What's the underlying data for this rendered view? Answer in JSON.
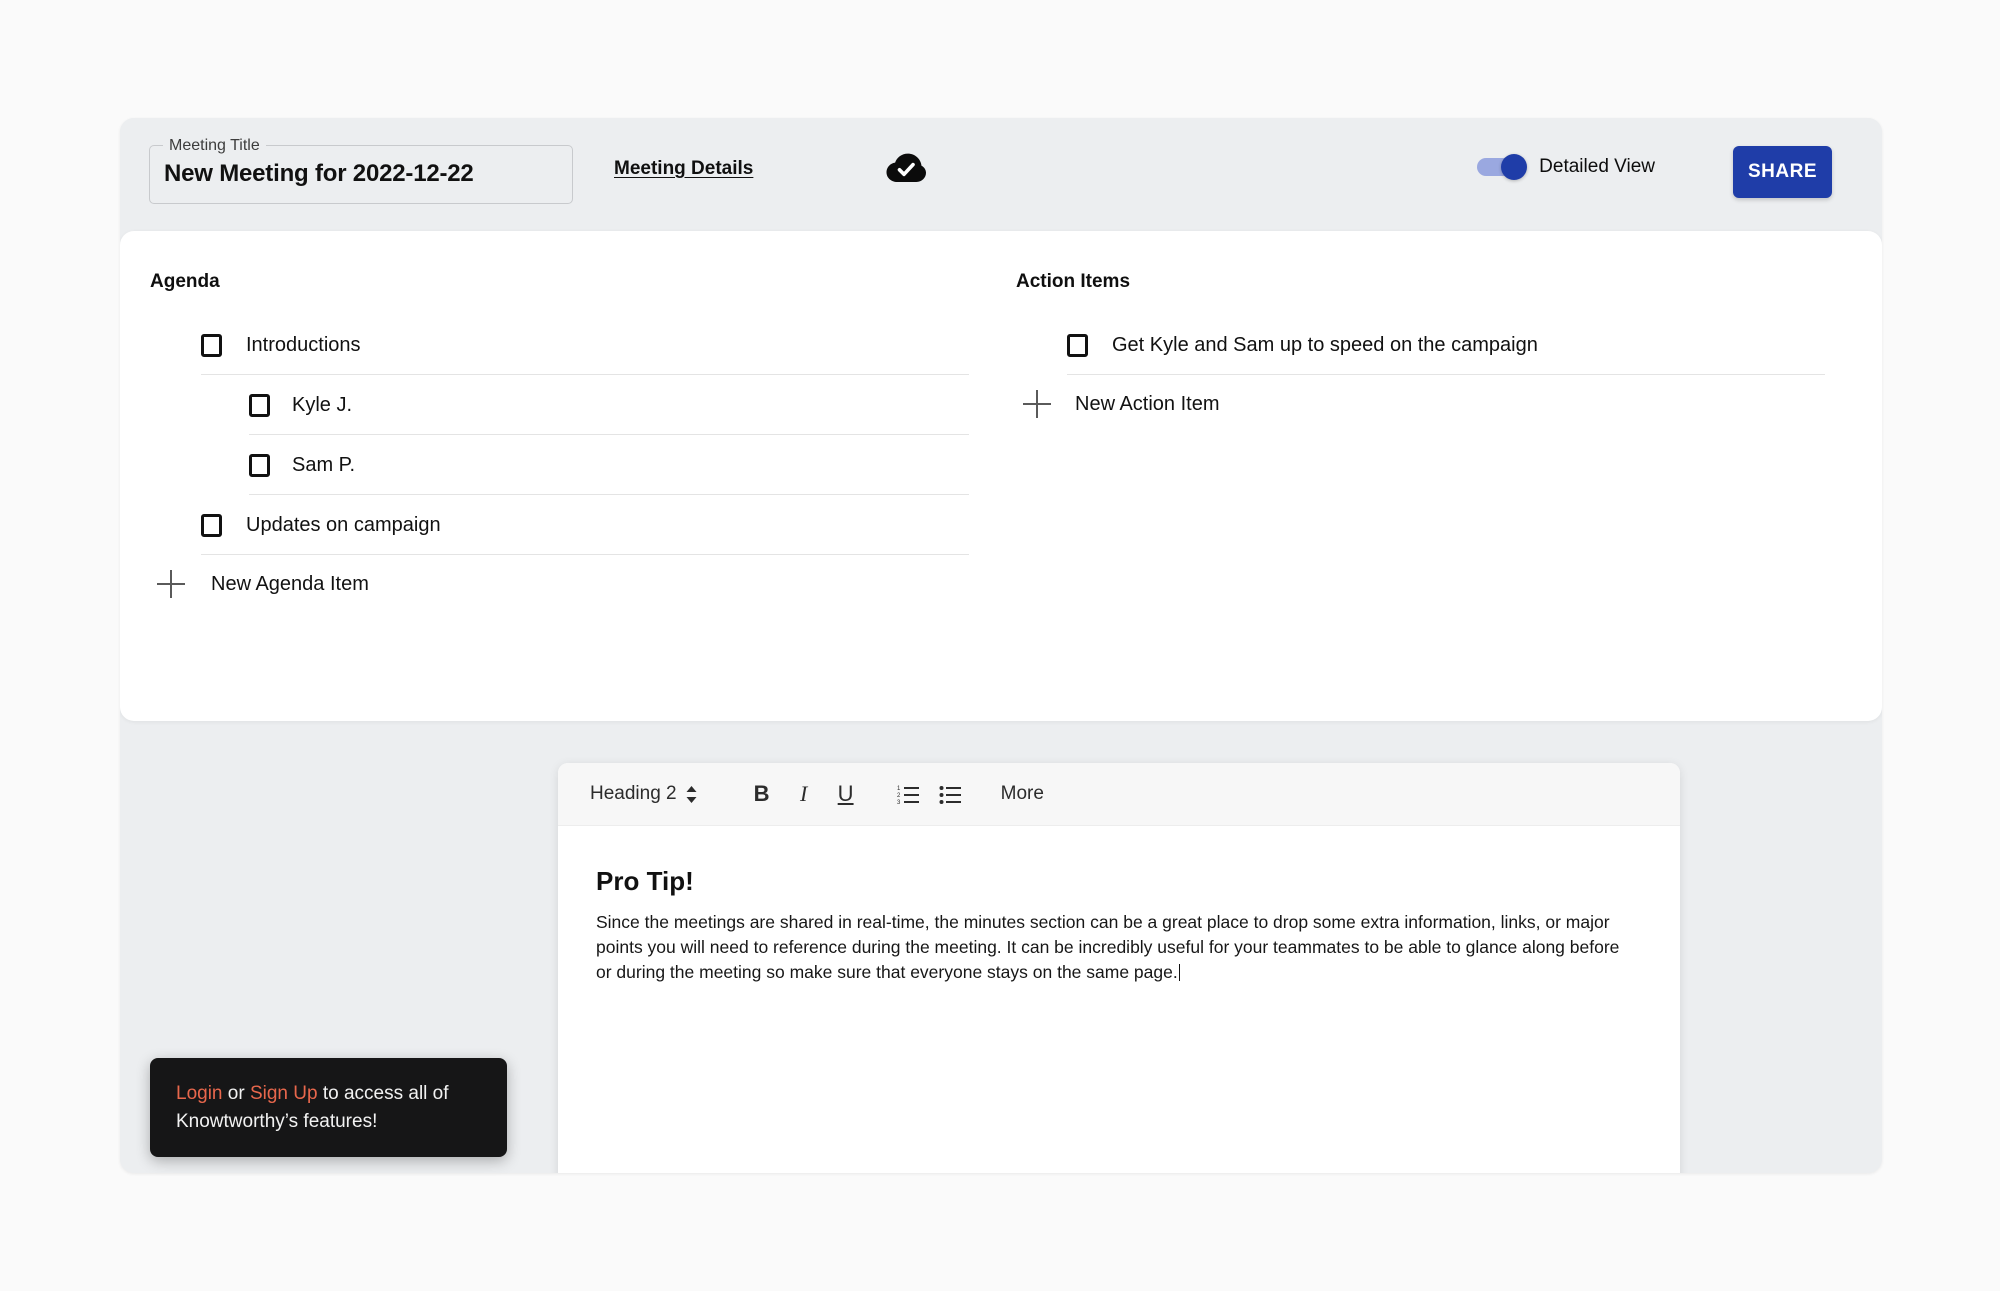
{
  "header": {
    "title_label": "Meeting Title",
    "title_value": "New Meeting for 2022-12-22",
    "meeting_details_link": "Meeting Details",
    "saved_icon": "cloud-check-icon",
    "toggle_label": "Detailed View",
    "toggle_on": true,
    "share_label": "SHARE",
    "accent_color": "#1f3da8"
  },
  "agenda": {
    "title": "Agenda",
    "items": [
      {
        "label": "Introductions",
        "level": 0,
        "checked": false
      },
      {
        "label": "Kyle J.",
        "level": 1,
        "checked": false
      },
      {
        "label": "Sam P.",
        "level": 1,
        "checked": false
      },
      {
        "label": "Updates on campaign",
        "level": 0,
        "checked": false
      }
    ],
    "new_item_label": "New Agenda Item"
  },
  "action_items": {
    "title": "Action Items",
    "items": [
      {
        "label": "Get Kyle and Sam up to speed on the campaign",
        "level": 0,
        "checked": false
      }
    ],
    "new_item_label": "New Action Item"
  },
  "editor": {
    "toolbar": {
      "style_value": "Heading 2",
      "bold_label": "B",
      "italic_label": "I",
      "underline_label": "U",
      "ordered_list_icon": "numbered-list-icon",
      "bullet_list_icon": "bullet-list-icon",
      "more_label": "More"
    },
    "heading": "Pro Tip!",
    "paragraph": "Since the meetings are shared in real-time, the minutes section can be a great place to drop some extra information, links, or major points you will need to reference during the meeting. It can be incredibly useful for your teammates to be able to glance along before or during the meeting so make sure that everyone stays on the same page."
  },
  "toast": {
    "login_label": "Login",
    "separator": " or ",
    "signup_label": "Sign Up",
    "rest": " to access all of Knowtworthy’s features!",
    "link_color": "#e8674c"
  },
  "chat": {
    "icon": "chat-bubble-icon",
    "color": "#1f3da8"
  }
}
